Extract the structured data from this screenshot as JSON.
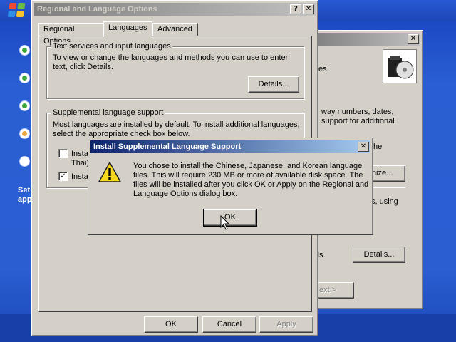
{
  "background": {
    "setup_text": [
      "Set",
      "app"
    ]
  },
  "back_window": {
    "close": "✕",
    "lines": [
      "es.",
      "way numbers, dates,",
      "support for additional",
      "the",
      "s, using",
      "ails."
    ],
    "customize_label": "omize...",
    "details_label": "Details...",
    "next_label": "ext >"
  },
  "regional_window": {
    "title": "Regional and Language Options",
    "help": "?",
    "close": "✕",
    "tabs": [
      {
        "label": "Regional Options",
        "active": false
      },
      {
        "label": "Languages",
        "active": true
      },
      {
        "label": "Advanced",
        "active": false
      }
    ],
    "text_services": {
      "group_label": "Text services and input languages",
      "description_1": "To view or change the languages and methods you can use to enter",
      "description_2": "text, click Details.",
      "details_label": "Details..."
    },
    "supplemental": {
      "group_label": "Supplemental language support",
      "description_1": "Most languages are installed by default. To install additional languages,",
      "description_2": "select the appropriate check box below.",
      "option_1_label": "Insta",
      "option_1_label_2": "Thai)",
      "option_1_checked": false,
      "option_2_label": "Insta",
      "option_2_checked": true
    },
    "buttons": {
      "ok": "OK",
      "cancel": "Cancel",
      "apply": "Apply"
    }
  },
  "message_box": {
    "title": "Install Supplemental Language Support",
    "close": "✕",
    "icon": "warning-icon",
    "message_1": "You chose to install the Chinese, Japanese, and Korean language",
    "message_2": "files. This will require 230 MB or more of available disk space. The",
    "message_3": "files will be installed after you click OK or Apply on the Regional and",
    "message_4": "Language Options dialog box.",
    "ok_label": "OK"
  }
}
